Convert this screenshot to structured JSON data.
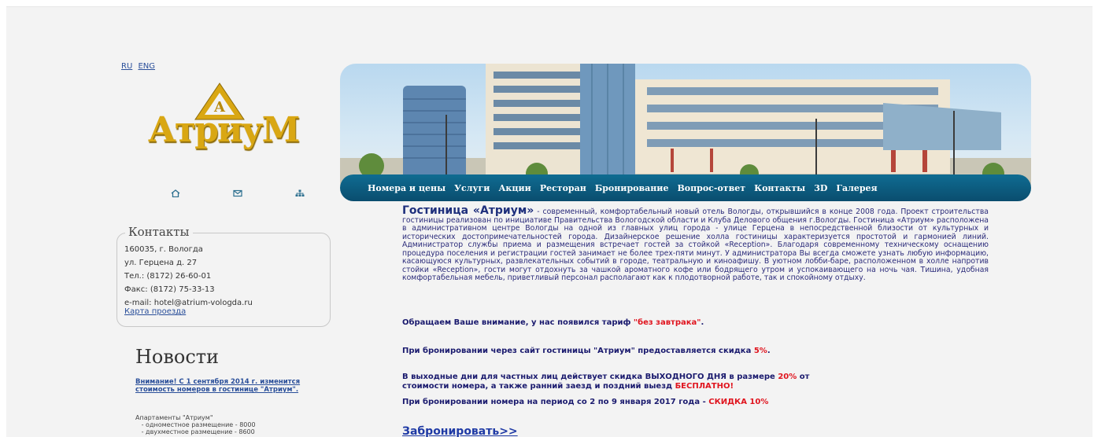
{
  "lang": {
    "ru": "RU",
    "eng": "ENG"
  },
  "logo": {
    "text": "АтриуМ"
  },
  "quick_icons": [
    "home-icon",
    "mail-icon",
    "sitemap-icon"
  ],
  "contacts": {
    "title": "Контакты",
    "lines": [
      "160035, г. Вологда",
      "ул. Герцена д. 27",
      "Тел.: (8172) 26-60-01",
      "Факс: (8172) 75-33-13",
      "e-mail: hotel@atrium-vologda.ru"
    ],
    "map_link": "Карта проезда"
  },
  "news": {
    "title": "Новости",
    "link": "Внимание! С 1 сентября 2014 г. изменится стоимость номеров в гостинице \"Атриум\".",
    "text": "Апартаменты \"Атриум\"\n   - одноместное размещение - 8000\n   - двухместное размещение - 8600"
  },
  "nav": [
    "Номера и цены",
    "Услуги",
    "Акции",
    "Ресторан",
    "Бронирование",
    "Вопрос-ответ",
    "Контакты",
    "3D",
    "Галерея"
  ],
  "main": {
    "hotel_name": "Гостиница «Атриум»",
    "intro": " - современный, комфортабельный новый отель Вологды, открывшийся в конце 2008 года. Проект строительства гостиницы реализован по инициативе Правительства Вологодской области и Клуба Делового общения г.Вологды. Гостиница «Атриум» расположена в административном центре Вологды на одной из главных улиц города - улице Герцена в непосредственной близости от культурных и исторических достопримечательностей города. Дизайнерское решение холла гостиницы характеризуется простотой и гармонией линий. Администратор службы приема и размещения встречает гостей за стойкой «Reception». Благодаря современному техническому оснащению процедура поселения и регистрации гостей занимает не более трех-пяти минут. У администратора Вы всегда сможете узнать любую информацию, касающуюся культурных, развлекательных событий в городе, театральную и киноафишу. В уютном лобби-баре, расположенном в холле напротив стойки «Reception», гости могут отдохнуть за чашкой ароматного кофе или бодрящего утром и успокаивающего на ночь чая. Тишина, удобная комфортабельная мебель, приветливый персонал располагают как к плодотворной работе, так и спокойному отдыху.",
    "p1_text": "Обращаем Ваше внимание, у нас появился тариф ",
    "p1_red": "\"без завтрака\"",
    "p1_end": ".",
    "p2_text": "При бронировании через сайт гостиницы \"Атриум\" предоставляется скидка ",
    "p2_red": "5%",
    "p2_end": ".",
    "p3_text": "В выходные дни для частных лиц действует скидка ВЫХОДНОГО ДНЯ в размере ",
    "p3_red1": "20%",
    "p3_mid": " от стоимости номера, а также ранний заезд и поздний выезд ",
    "p3_red2": "БЕСПЛАТНО!",
    "p4_text": "При бронировании номера на период со 2 по 9 января 2017 года - ",
    "p4_red": "СКИДКА 10%",
    "book": "Забронировать>>"
  },
  "colors": {
    "nav": "#0f6c92",
    "accent_red": "#e0141e",
    "text_blue": "#1a1a6e",
    "logo_gold": "#d9a713"
  }
}
